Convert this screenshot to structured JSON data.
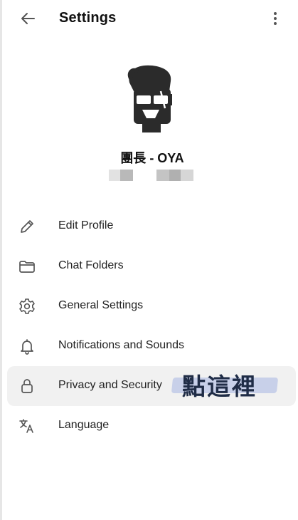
{
  "header": {
    "title": "Settings",
    "back_icon": "arrow-left-icon",
    "more_icon": "more-vertical-icon"
  },
  "profile": {
    "name": "團長 - OYA",
    "avatar_icon": "avatar-cartoon-icon"
  },
  "menu": {
    "items": [
      {
        "label": "Edit Profile",
        "icon": "pencil-icon"
      },
      {
        "label": "Chat Folders",
        "icon": "folder-icon"
      },
      {
        "label": "General Settings",
        "icon": "gear-icon"
      },
      {
        "label": "Notifications and Sounds",
        "icon": "bell-icon"
      },
      {
        "label": "Privacy and Security",
        "icon": "lock-icon",
        "active": true
      },
      {
        "label": "Language",
        "icon": "translate-icon"
      }
    ]
  },
  "annotation": {
    "text": "點這裡",
    "color": "#1f2c46",
    "highlight_color": "#c5cee8"
  }
}
